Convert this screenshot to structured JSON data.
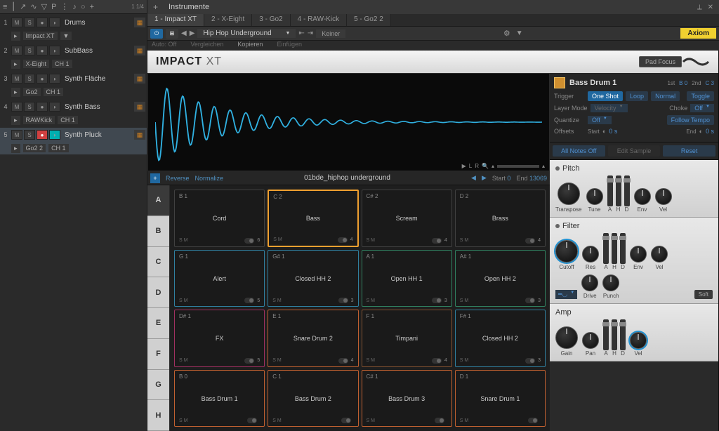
{
  "header": {
    "title": "Instrumente",
    "timeSig": "1 1/4"
  },
  "tracks": [
    {
      "num": "1",
      "name": "Drums",
      "plugin": "Impact XT",
      "ch": ""
    },
    {
      "num": "2",
      "name": "SubBass",
      "plugin": "X-Eight",
      "ch": "CH 1"
    },
    {
      "num": "3",
      "name": "Synth Fläche",
      "plugin": "Go2",
      "ch": "CH 1"
    },
    {
      "num": "4",
      "name": "Synth Bass",
      "plugin": "RAWKick",
      "ch": "CH 1"
    },
    {
      "num": "5",
      "name": "Synth Pluck",
      "plugin": "Go2 2",
      "ch": "CH 1"
    }
  ],
  "tabs": [
    "1 - Impact XT",
    "2 - X-Eight",
    "3 - Go2",
    "4 - RAW-Kick",
    "5 - Go2 2"
  ],
  "preset": "Hip Hop Underground",
  "keiner": "Keiner",
  "editActions": {
    "auto": "Auto: Off",
    "compare": "Vergleichen",
    "copy": "Kopieren",
    "paste": "Einfügen"
  },
  "axiom": "Axiom",
  "instName": "IMPACT",
  "instSuffix": "XT",
  "padFocus": "Pad Focus",
  "sampleBar": {
    "reverse": "Reverse",
    "normalize": "Normalize",
    "name": "01bde_hiphop underground",
    "start": "Start",
    "startVal": "0",
    "end": "End",
    "endVal": "13069"
  },
  "banks": [
    "A",
    "B",
    "C",
    "D",
    "E",
    "F",
    "G",
    "H"
  ],
  "pads": [
    {
      "note": "B 1",
      "name": "Cord",
      "cnt": "6",
      "cls": ""
    },
    {
      "note": "C 2",
      "name": "Bass",
      "cnt": "4",
      "cls": "selected"
    },
    {
      "note": "C# 2",
      "name": "Scream",
      "cnt": "4",
      "cls": ""
    },
    {
      "note": "D 2",
      "name": "Brass",
      "cnt": "4",
      "cls": ""
    },
    {
      "note": "G 1",
      "name": "Alert",
      "cnt": "5",
      "cls": "c2"
    },
    {
      "note": "G# 1",
      "name": "Closed HH 2",
      "cnt": "3",
      "cls": "c2"
    },
    {
      "note": "A 1",
      "name": "Open HH 1",
      "cnt": "3",
      "cls": "c3"
    },
    {
      "note": "A# 1",
      "name": "Open HH 2",
      "cnt": "3",
      "cls": "c3"
    },
    {
      "note": "D# 1",
      "name": "FX",
      "cnt": "5",
      "cls": "c5"
    },
    {
      "note": "E 1",
      "name": "Snare Drum 2",
      "cnt": "4",
      "cls": "c1"
    },
    {
      "note": "F 1",
      "name": "Timpani",
      "cnt": "4",
      "cls": "c4"
    },
    {
      "note": "F# 1",
      "name": "Closed HH 2",
      "cnt": "3",
      "cls": "c2"
    },
    {
      "note": "B 0",
      "name": "Bass Drum 1",
      "cnt": "",
      "cls": "c1"
    },
    {
      "note": "C 1",
      "name": "Bass Drum 2",
      "cnt": "",
      "cls": "c1"
    },
    {
      "note": "C# 1",
      "name": "Bass Drum 3",
      "cnt": "",
      "cls": "c1"
    },
    {
      "note": "D 1",
      "name": "Snare Drum 1",
      "cnt": "",
      "cls": "c1"
    }
  ],
  "padInfo": {
    "name": "Bass Drum 1",
    "first": "1st",
    "firstNote": "B 0",
    "second": "2nd",
    "secondNote": "C 3"
  },
  "params": {
    "trigger": "Trigger",
    "oneShot": "One Shot",
    "loop": "Loop",
    "normal": "Normal",
    "toggle": "Toggle",
    "layerMode": "Layer Mode",
    "velocity": "Velocity",
    "choke": "Choke",
    "chokeVal": "Off",
    "quantize": "Quantize",
    "quantizeVal": "Off",
    "followTempo": "Follow Tempo",
    "offsets": "Offsets",
    "startLbl": "Start",
    "startVal": "0 s",
    "endLbl": "End",
    "endVal": "0 s"
  },
  "actions": {
    "allNotesOff": "All Notes Off",
    "editSample": "Edit Sample",
    "reset": "Reset"
  },
  "fx": {
    "pitch": {
      "title": "Pitch",
      "transpose": "Transpose",
      "tune": "Tune",
      "env": "Env",
      "vel": "Vel"
    },
    "filter": {
      "title": "Filter",
      "cutoff": "Cutoff",
      "res": "Res",
      "drive": "Drive",
      "punch": "Punch",
      "env": "Env",
      "vel": "Vel",
      "soft": "Soft"
    },
    "amp": {
      "title": "Amp",
      "gain": "Gain",
      "pan": "Pan",
      "vel": "Vel"
    },
    "ahd": {
      "a": "A",
      "h": "H",
      "d": "D"
    }
  }
}
